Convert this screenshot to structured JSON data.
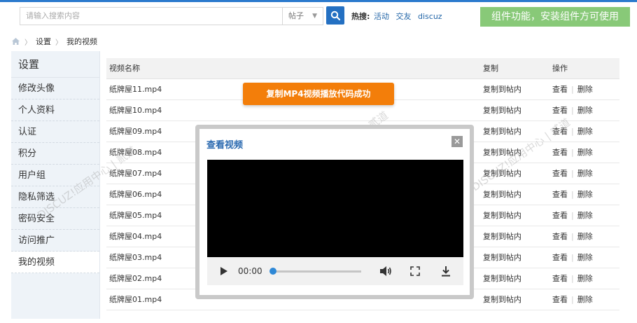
{
  "search": {
    "placeholder": "请输入搜索内容",
    "type_select": "帖子",
    "hot_label": "热搜:",
    "hot_links": [
      "活动",
      "交友",
      "discuz"
    ]
  },
  "banner": {
    "text": "组件功能，安装组件方可使用"
  },
  "breadcrumb": {
    "items": [
      "设置",
      "我的视频"
    ]
  },
  "sidebar": {
    "title": "设置",
    "items": [
      {
        "label": "修改头像",
        "active": false
      },
      {
        "label": "个人资料",
        "active": false
      },
      {
        "label": "认证",
        "active": false
      },
      {
        "label": "积分",
        "active": false
      },
      {
        "label": "用户组",
        "active": false
      },
      {
        "label": "隐私筛选",
        "active": false
      },
      {
        "label": "密码安全",
        "active": false
      },
      {
        "label": "访问推广",
        "active": false
      },
      {
        "label": "我的视频",
        "active": true
      }
    ]
  },
  "table": {
    "headers": {
      "name": "视频名称",
      "copy": "复制",
      "ops": "操作"
    },
    "rows": [
      {
        "name": "纸牌屋11.mp4",
        "copy": "复制到帖内",
        "view": "查看",
        "delete": "删除"
      },
      {
        "name": "纸牌屋10.mp4",
        "copy": "复制到帖内",
        "view": "查看",
        "delete": "删除"
      },
      {
        "name": "纸牌屋09.mp4",
        "copy": "复制到帖内",
        "view": "查看",
        "delete": "删除"
      },
      {
        "name": "纸牌屋08.mp4",
        "copy": "复制到帖内",
        "view": "查看",
        "delete": "删除"
      },
      {
        "name": "纸牌屋07.mp4",
        "copy": "复制到帖内",
        "view": "查看",
        "delete": "删除"
      },
      {
        "name": "纸牌屋06.mp4",
        "copy": "复制到帖内",
        "view": "查看",
        "delete": "删除"
      },
      {
        "name": "纸牌屋05.mp4",
        "copy": "复制到帖内",
        "view": "查看",
        "delete": "删除"
      },
      {
        "name": "纸牌屋04.mp4",
        "copy": "复制到帖内",
        "view": "查看",
        "delete": "删除"
      },
      {
        "name": "纸牌屋03.mp4",
        "copy": "复制到帖内",
        "view": "查看",
        "delete": "删除"
      },
      {
        "name": "纸牌屋02.mp4",
        "copy": "复制到帖内",
        "view": "查看",
        "delete": "删除"
      },
      {
        "name": "纸牌屋01.mp4",
        "copy": "复制到帖内",
        "view": "查看",
        "delete": "删除"
      }
    ]
  },
  "toast": {
    "text": "复制MP4视频播放代码成功"
  },
  "modal": {
    "title": "查看视频",
    "close_symbol": "✕",
    "player": {
      "time": "00:00",
      "progress": 0
    }
  },
  "watermark": {
    "text": "DISCUZ!应用中心 | 贰道"
  },
  "colors": {
    "accent": "#2470c2",
    "banner": "#88c978",
    "toast": "#f37e0a",
    "title": "#2b6ab0"
  }
}
